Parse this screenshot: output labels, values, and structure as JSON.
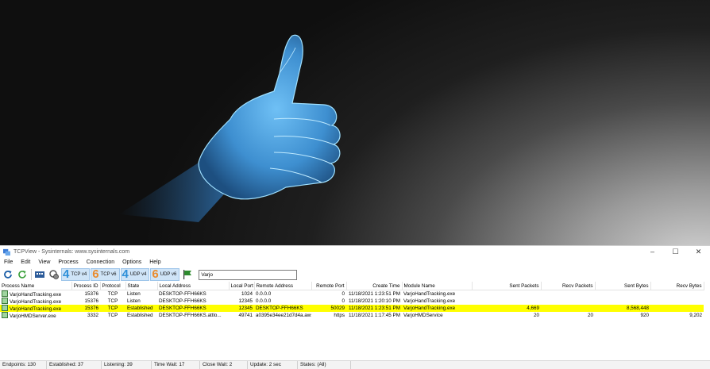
{
  "window": {
    "title": "TCPView - Sysinternals: www.sysinternals.com",
    "controls": [
      "minimize",
      "maximize",
      "close"
    ]
  },
  "menu": [
    "File",
    "Edit",
    "View",
    "Process",
    "Connection",
    "Options",
    "Help"
  ],
  "toolbar": {
    "refresh_icon": "refresh-icon",
    "autorefresh_icon": "autorefresh-icon",
    "tcp_v4": {
      "num": "4",
      "label": "TCP v4"
    },
    "tcp_v6": {
      "num": "6",
      "label": "TCP v6"
    },
    "udp_v4": {
      "num": "4",
      "label": "UDP v4"
    },
    "udp_v6": {
      "num": "6",
      "label": "UDP v6"
    },
    "filter_value": "Varjo"
  },
  "columns": [
    "Process Name",
    "Process ID",
    "Protocol",
    "State",
    "Local Address",
    "Local Port",
    "Remote Address",
    "Remote Port",
    "Create Time",
    "Module Name",
    "Sent Packets",
    "Recv Packets",
    "Sent Bytes",
    "Recv Bytes"
  ],
  "rows": [
    [
      "VarjoHandTracking.exe",
      "15376",
      "TCP",
      "Listen",
      "DESKTOP-FFH66KS",
      "1024",
      "0.0.0.0",
      "0",
      "11/18/2021 1:23:51 PM",
      "VarjoHandTracking.exe",
      "",
      "",
      "",
      ""
    ],
    [
      "VarjoHandTracking.exe",
      "15376",
      "TCP",
      "Listen",
      "DESKTOP-FFH66KS",
      "12345",
      "0.0.0.0",
      "0",
      "11/18/2021 1:20:10 PM",
      "VarjoHandTracking.exe",
      "",
      "",
      "",
      ""
    ],
    [
      "VarjoHandTracking.exe",
      "15376",
      "TCP",
      "Established",
      "DESKTOP-FFH66KS",
      "12345",
      "DESKTOP-FFH66KS",
      "50029",
      "11/18/2021 1:23:51 PM",
      "VarjoHandTracking.exe",
      "4,669",
      "",
      "8,568,448",
      ""
    ],
    [
      "VarjoHMDServer.exe",
      "3332",
      "TCP",
      "Established",
      "DESKTOP-FFH66KS.attlo...",
      "49741",
      "a0395e34ee21d7d4a.aws...",
      "https",
      "11/18/2021 1:17:45 PM",
      "VarjoHMDService",
      "20",
      "20",
      "920",
      "9,202"
    ]
  ],
  "selected_row": 2,
  "status": [
    "Endpoints: 130",
    "Established: 37",
    "Listening: 39",
    "Time Wait: 17",
    "Close Wait: 2",
    "Update: 2 sec",
    "States: (All)"
  ],
  "colors": {
    "selection": "#ffff00",
    "hand": "#4aa0e0"
  }
}
